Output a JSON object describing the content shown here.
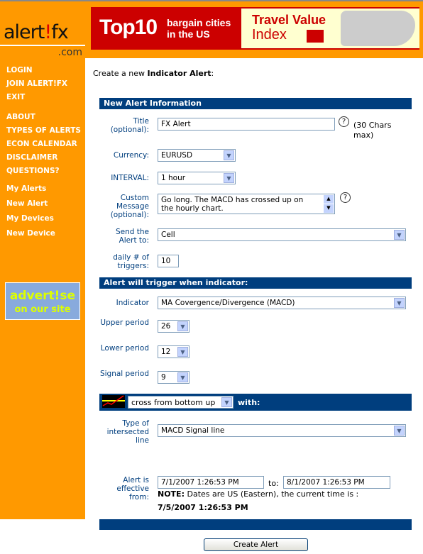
{
  "logo": {
    "text_main": "alert",
    "text_bang": "!",
    "text_fx": "fx",
    "text_com": ".com"
  },
  "banner": {
    "top10": "Top10",
    "sub1": "bargain cities",
    "sub2": "in the US",
    "tv": "Travel Value",
    "idx": "Index"
  },
  "sidebar": {
    "items": [
      "LOGIN",
      "JOIN ALERT!FX",
      "EXIT",
      "ABOUT",
      "TYPES OF ALERTS",
      "ECON CALENDAR",
      "DISCLAIMER",
      "QUESTIONS?",
      "My Alerts",
      "New Alert",
      "My Devices",
      "New Device"
    ],
    "advert_line1": "advert!se",
    "advert_line2": "on our site"
  },
  "intro": {
    "prefix": "Create a new ",
    "bold": "Indicator Alert",
    ":": ":"
  },
  "section1": "New Alert Information",
  "form": {
    "title_label": "Title (optional):",
    "title_value": "FX Alert",
    "title_note": "(30 Chars max)",
    "currency_label": "Currency:",
    "currency_value": "EURUSD",
    "interval_label": "INTERVAL:",
    "interval_value": "1 hour",
    "message_label": "Custom Message (optional):",
    "message_value1": "Go long. The MACD has crossed up on",
    "message_value2": "the hourly chart.",
    "send_label": "Send the Alert to:",
    "send_value": "Cell",
    "triggers_label": "daily # of triggers:",
    "triggers_value": "10"
  },
  "section2": "Alert will trigger when indicator:",
  "indicator": {
    "indicator_label": "Indicator",
    "indicator_value": "MA Covergence/Divergence (MACD)",
    "upper_label": "Upper period",
    "upper_value": "26",
    "lower_label": "Lower period",
    "lower_value": "12",
    "signal_label": "Signal period",
    "signal_value": "9"
  },
  "cross": {
    "value": "cross from bottom up",
    "with": "with:"
  },
  "intersect": {
    "label": "Type of intersected line",
    "value": "MACD Signal line"
  },
  "dates": {
    "label": "Alert is effective from:",
    "from": "7/1/2007 1:26:53 PM",
    "to_label": "to:",
    "to": "8/1/2007 1:26:53 PM",
    "note_bold": "NOTE:",
    "note": " Dates are US (Eastern), the current time is :",
    "current": "7/5/2007 1:26:53 PM"
  },
  "submit": "Create Alert",
  "colors": {
    "orange": "#ff9900",
    "navy": "#003e7e"
  }
}
